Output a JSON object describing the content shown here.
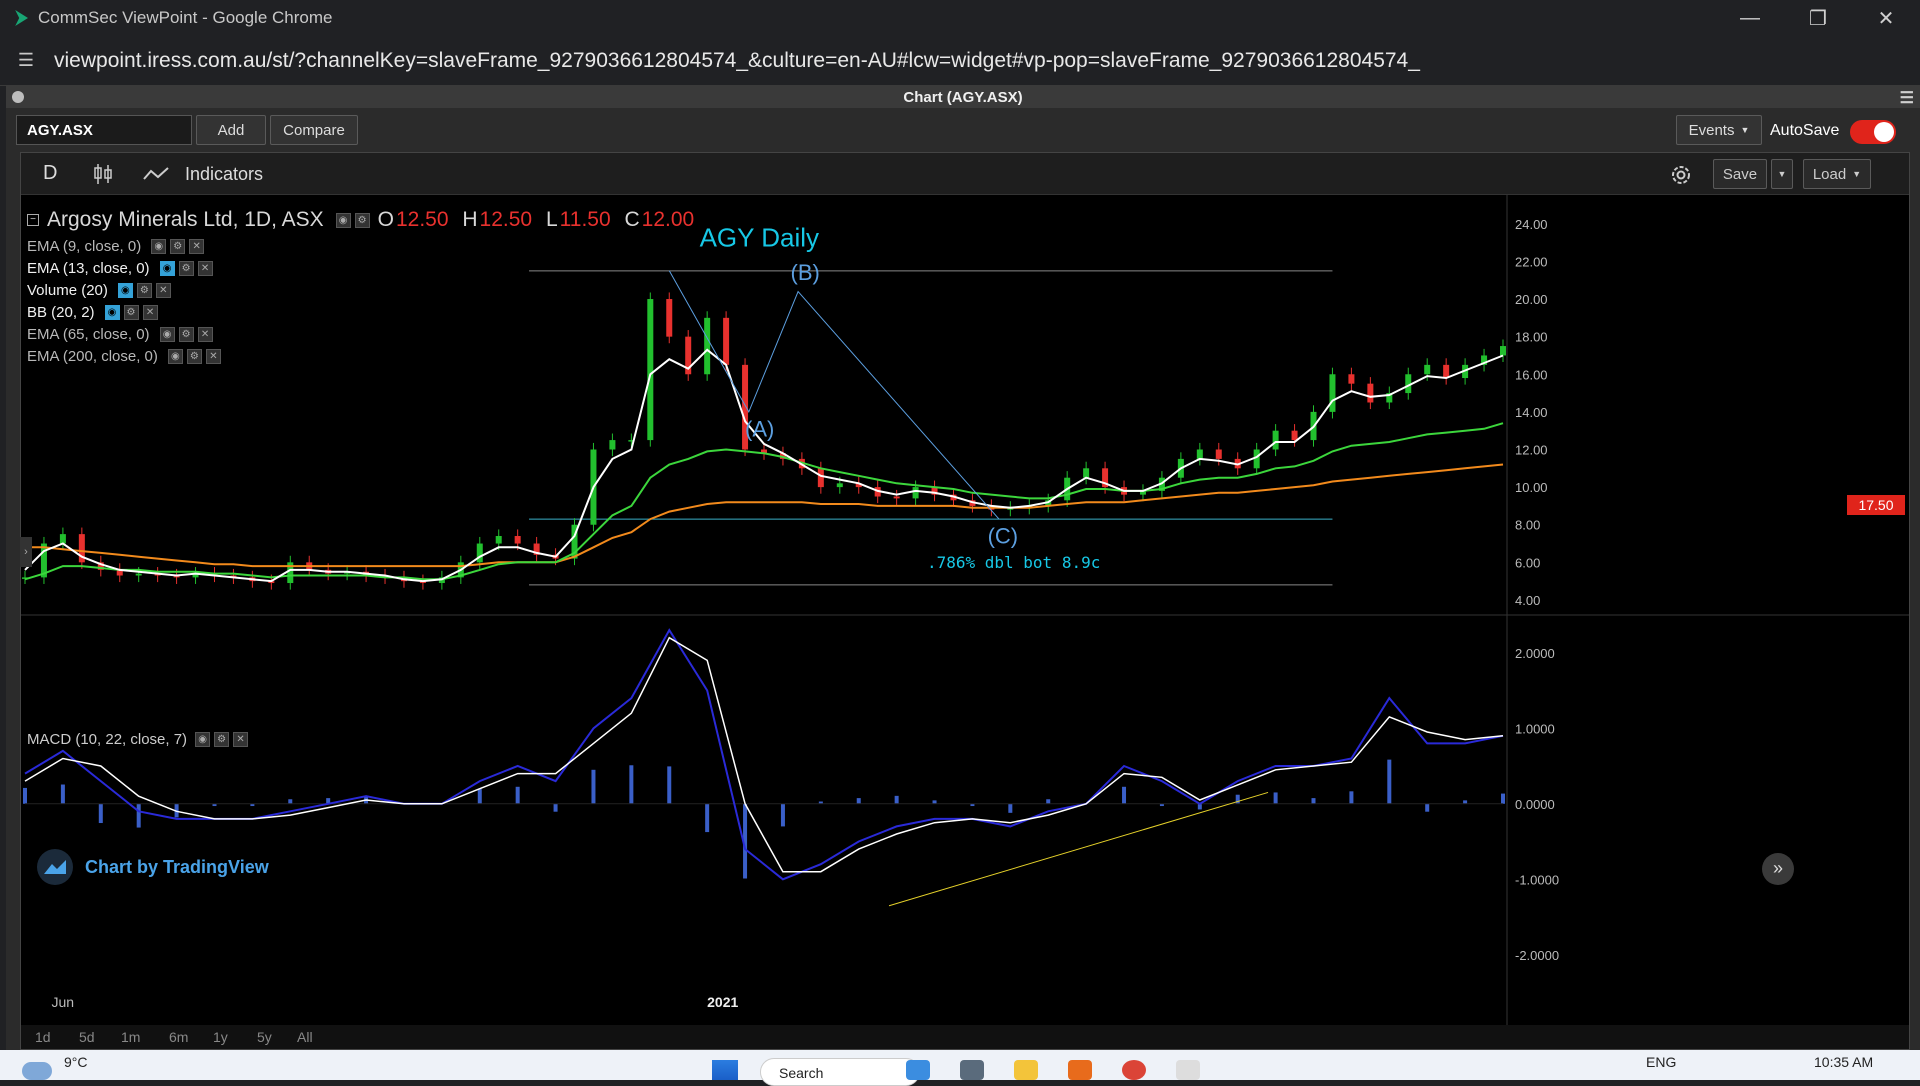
{
  "window": {
    "title": "CommSec ViewPoint - Google Chrome",
    "url": "viewpoint.iress.com.au/st/?channelKey=slaveFrame_9279036612804574_&culture=en-AU#lcw=widget#vp-pop=slaveFrame_9279036612804574_"
  },
  "frame": {
    "title": "Chart (AGY.ASX)"
  },
  "toolbar": {
    "symbol": "AGY.ASX",
    "add_label": "Add",
    "compare_label": "Compare",
    "events_label": "Events",
    "autosave_label": "AutoSave"
  },
  "tv_toolbar": {
    "resolution": "D",
    "indicators_label": "Indicators",
    "save_label": "Save",
    "load_label": "Load"
  },
  "legend": {
    "symbol_line": "Argosy Minerals Ltd, 1D, ASX",
    "ohlc": {
      "o_label": "O",
      "o": "12.50",
      "h_label": "H",
      "h": "12.50",
      "l_label": "L",
      "l": "11.50",
      "c_label": "C",
      "c": "12.00"
    },
    "indicators": [
      {
        "label": "EMA (9, close, 0)",
        "visible": false
      },
      {
        "label": "EMA (13, close, 0)",
        "visible": true
      },
      {
        "label": "Volume (20)",
        "visible": true
      },
      {
        "label": "BB (20, 2)",
        "visible": true
      },
      {
        "label": "EMA (65, close, 0)",
        "visible": false
      },
      {
        "label": "EMA (200, close, 0)",
        "visible": false
      }
    ],
    "macd_label": "MACD (10, 22, close, 7)"
  },
  "annotations": {
    "title": "AGY Daily",
    "wave_a": "(A)",
    "wave_b": "(B)",
    "wave_c": "(C)",
    "note": ".786% dbl bot 8.9c"
  },
  "last_price": "17.50",
  "branding": {
    "tv_label": "Chart by TradingView"
  },
  "ranges": [
    "1d",
    "5d",
    "1m",
    "6m",
    "1y",
    "5y",
    "All"
  ],
  "taskbar": {
    "temperature": "9°C",
    "search_placeholder": "Search",
    "language": "ENG",
    "time": "10:35 AM"
  },
  "colors": {
    "up": "#22c02e",
    "down": "#e8312e",
    "ema13": "#ffffff",
    "ema65": "#3cd63c",
    "ema200": "#f28a1c",
    "macd": "#2a2ad8",
    "signal": "#ffffff",
    "annotation": "#5c9fe0",
    "title": "#17c8e6"
  },
  "chart_data": {
    "type": "line",
    "title": "AGY Daily",
    "x_tick_labels": [
      "Jun",
      "2021"
    ],
    "price_axis": {
      "ylim": [
        3.2,
        25.0
      ],
      "ticks": [
        4.0,
        6.0,
        8.0,
        10.0,
        12.0,
        14.0,
        16.0,
        18.0,
        20.0,
        22.0,
        24.0
      ]
    },
    "macd_axis": {
      "ylim": [
        -2.4,
        2.5
      ],
      "ticks": [
        -2.0,
        -1.0,
        0.0,
        1.0,
        2.0
      ]
    },
    "price_series": {
      "name": "Argosy Minerals Ltd, 1D, ASX",
      "x": [
        0,
        5,
        10,
        15,
        20,
        25,
        30,
        35,
        40,
        45,
        50,
        55,
        60,
        65,
        70,
        75,
        80,
        85,
        90,
        95,
        100,
        105,
        110,
        115,
        120,
        125,
        130,
        135,
        140,
        145,
        150,
        155,
        160,
        165,
        170,
        175,
        180,
        185,
        190,
        195,
        200,
        205,
        210,
        215,
        220,
        225,
        230,
        235,
        240,
        245,
        250,
        255,
        260,
        265,
        270,
        275,
        280,
        285,
        290,
        295,
        300,
        305,
        310,
        315,
        320,
        325,
        330,
        335,
        340,
        345,
        350,
        355,
        360,
        365,
        370,
        375,
        380,
        385,
        390
      ],
      "close": [
        5.2,
        7.0,
        7.5,
        6.0,
        5.6,
        5.3,
        5.4,
        5.3,
        5.2,
        5.4,
        5.3,
        5.2,
        5.0,
        4.9,
        6.0,
        5.6,
        5.4,
        5.5,
        5.3,
        5.2,
        5.0,
        4.9,
        5.2,
        6.0,
        7.0,
        7.4,
        7.0,
        6.4,
        6.2,
        8.0,
        12.0,
        12.5,
        12.5,
        20.0,
        18.0,
        16.0,
        19.0,
        16.5,
        12.0,
        11.8,
        11.5,
        11.0,
        10.0,
        10.2,
        10.0,
        9.5,
        9.4,
        10.0,
        9.6,
        9.3,
        9.0,
        8.8,
        8.9,
        9.0,
        9.3,
        10.5,
        11.0,
        10.0,
        9.6,
        9.8,
        10.5,
        11.5,
        12.0,
        11.5,
        11.0,
        12.0,
        13.0,
        12.5,
        14.0,
        16.0,
        15.5,
        14.5,
        15.0,
        16.0,
        16.5,
        15.8,
        16.5,
        17.0,
        17.5
      ],
      "ema13": [
        5.6,
        6.6,
        7.0,
        6.3,
        5.9,
        5.6,
        5.5,
        5.4,
        5.3,
        5.4,
        5.3,
        5.2,
        5.1,
        5.0,
        5.6,
        5.6,
        5.5,
        5.5,
        5.4,
        5.3,
        5.1,
        5.0,
        5.1,
        5.6,
        6.3,
        6.8,
        6.8,
        6.5,
        6.3,
        7.4,
        10.0,
        11.5,
        12.0,
        16.0,
        16.8,
        16.3,
        17.3,
        16.5,
        13.5,
        12.3,
        11.8,
        11.2,
        10.6,
        10.4,
        10.2,
        9.8,
        9.6,
        9.8,
        9.7,
        9.5,
        9.2,
        9.0,
        8.9,
        9.0,
        9.2,
        9.9,
        10.5,
        10.2,
        9.8,
        9.8,
        10.2,
        11.0,
        11.5,
        11.4,
        11.2,
        11.6,
        12.4,
        12.4,
        13.2,
        14.6,
        15.1,
        14.8,
        14.9,
        15.4,
        15.9,
        15.8,
        16.2,
        16.6,
        17.0
      ],
      "ema65": [
        5.1,
        5.4,
        5.8,
        5.8,
        5.7,
        5.6,
        5.6,
        5.5,
        5.5,
        5.5,
        5.4,
        5.4,
        5.3,
        5.2,
        5.3,
        5.3,
        5.3,
        5.3,
        5.3,
        5.2,
        5.2,
        5.1,
        5.1,
        5.3,
        5.6,
        5.9,
        6.0,
        6.0,
        6.0,
        6.5,
        7.5,
        8.5,
        9.0,
        10.5,
        11.2,
        11.5,
        11.9,
        12.0,
        11.9,
        11.8,
        11.6,
        11.3,
        11.0,
        10.8,
        10.6,
        10.4,
        10.2,
        10.1,
        10.0,
        9.9,
        9.7,
        9.6,
        9.5,
        9.4,
        9.4,
        9.6,
        9.9,
        9.9,
        9.8,
        9.8,
        9.9,
        10.2,
        10.4,
        10.5,
        10.5,
        10.7,
        11.0,
        11.1,
        11.4,
        11.9,
        12.2,
        12.3,
        12.4,
        12.6,
        12.8,
        12.9,
        13.0,
        13.1,
        13.4
      ],
      "ema200": [
        6.8,
        6.8,
        6.7,
        6.6,
        6.5,
        6.4,
        6.3,
        6.2,
        6.1,
        6.0,
        5.9,
        5.9,
        5.8,
        5.8,
        5.8,
        5.8,
        5.8,
        5.8,
        5.8,
        5.8,
        5.8,
        5.8,
        5.8,
        5.8,
        5.9,
        6.0,
        6.0,
        6.0,
        6.0,
        6.3,
        6.8,
        7.3,
        7.6,
        8.3,
        8.7,
        8.9,
        9.1,
        9.2,
        9.2,
        9.2,
        9.2,
        9.2,
        9.1,
        9.1,
        9.1,
        9.0,
        9.0,
        9.0,
        9.0,
        9.0,
        8.9,
        8.9,
        8.9,
        8.9,
        9.0,
        9.1,
        9.2,
        9.2,
        9.2,
        9.3,
        9.4,
        9.5,
        9.6,
        9.7,
        9.7,
        9.8,
        9.9,
        10.0,
        10.1,
        10.3,
        10.4,
        10.5,
        10.6,
        10.7,
        10.8,
        10.9,
        11.0,
        11.1,
        11.2
      ]
    },
    "macd_series": {
      "name": "MACD (10, 22, close, 7)",
      "x": [
        0,
        10,
        20,
        30,
        40,
        50,
        60,
        70,
        80,
        90,
        100,
        110,
        120,
        130,
        140,
        150,
        160,
        170,
        180,
        190,
        200,
        210,
        220,
        230,
        240,
        250,
        260,
        270,
        280,
        290,
        300,
        310,
        320,
        330,
        340,
        350,
        360,
        370,
        380,
        390
      ],
      "macd": [
        0.4,
        0.7,
        0.3,
        -0.1,
        -0.2,
        -0.2,
        -0.2,
        -0.1,
        0.0,
        0.1,
        0.0,
        0.0,
        0.3,
        0.5,
        0.3,
        1.0,
        1.4,
        2.3,
        1.5,
        -0.6,
        -1.0,
        -0.8,
        -0.5,
        -0.3,
        -0.2,
        -0.2,
        -0.3,
        -0.1,
        0.0,
        0.5,
        0.3,
        0.0,
        0.3,
        0.5,
        0.5,
        0.6,
        1.4,
        0.8,
        0.8,
        0.9
      ],
      "signal": [
        0.3,
        0.6,
        0.5,
        0.1,
        -0.1,
        -0.2,
        -0.2,
        -0.15,
        -0.05,
        0.05,
        0.0,
        0.0,
        0.2,
        0.4,
        0.4,
        0.8,
        1.2,
        2.2,
        1.9,
        0.0,
        -0.9,
        -0.9,
        -0.6,
        -0.4,
        -0.25,
        -0.2,
        -0.25,
        -0.15,
        0.0,
        0.4,
        0.35,
        0.05,
        0.25,
        0.45,
        0.5,
        0.55,
        1.15,
        0.95,
        0.85,
        0.9
      ]
    }
  }
}
